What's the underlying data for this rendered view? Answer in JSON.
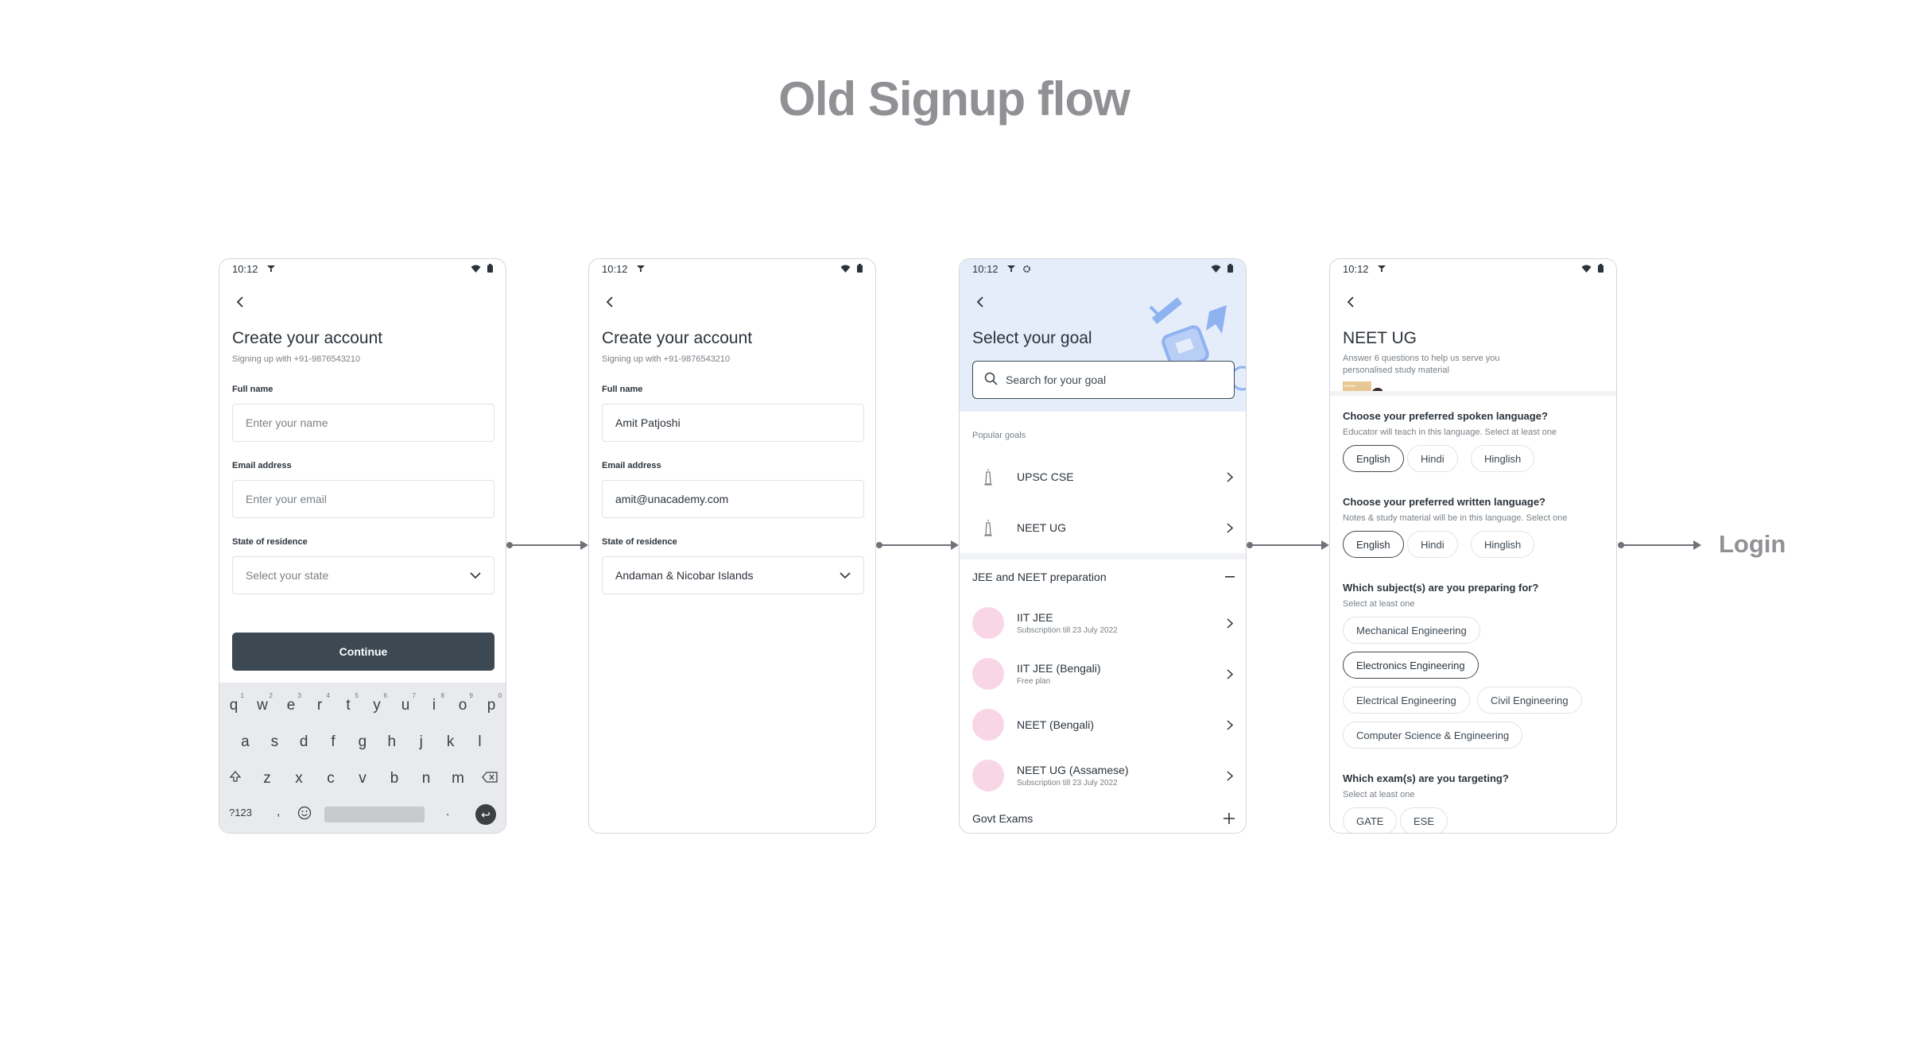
{
  "page": {
    "title": "Old Signup flow",
    "end_label": "Login"
  },
  "statusbar": {
    "time": "10:12"
  },
  "screen1": {
    "title": "Create your account",
    "subtitle": "Signing up with +91-9876543210",
    "fullname_label": "Full name",
    "fullname_placeholder": "Enter your name",
    "email_label": "Email address",
    "email_placeholder": "Enter your email",
    "state_label": "State of residence",
    "state_placeholder": "Select your state",
    "continue_label": "Continue",
    "keyboard": {
      "row1": [
        "q",
        "w",
        "e",
        "r",
        "t",
        "y",
        "u",
        "i",
        "o",
        "p"
      ],
      "row1_nums": [
        "1",
        "2",
        "3",
        "4",
        "5",
        "6",
        "7",
        "8",
        "9",
        "0"
      ],
      "row2": [
        "a",
        "s",
        "d",
        "f",
        "g",
        "h",
        "j",
        "k",
        "l"
      ],
      "row3": [
        "z",
        "x",
        "c",
        "v",
        "b",
        "n",
        "m"
      ],
      "symbols": "?123",
      "comma": ",",
      "period": "."
    }
  },
  "screen2": {
    "title": "Create your account",
    "subtitle": "Signing up with +91-9876543210",
    "fullname_label": "Full name",
    "fullname_value": "Amit Patjoshi",
    "email_label": "Email address",
    "email_value": "amit@unacademy.com",
    "state_label": "State of residence",
    "state_value": "Andaman & Nicobar Islands"
  },
  "screen3": {
    "title": "Select your goal",
    "search_placeholder": "Search for your goal",
    "popular_caption": "Popular goals",
    "popular": [
      {
        "name": "UPSC CSE"
      },
      {
        "name": "NEET UG"
      }
    ],
    "section1_title": "JEE and NEET preparation",
    "section1_items": [
      {
        "name": "IIT JEE",
        "sub": "Subscription till 23 July 2022"
      },
      {
        "name": "IIT JEE (Bengali)",
        "sub": "Free plan"
      },
      {
        "name": "NEET (Bengali)",
        "sub": ""
      },
      {
        "name": "NEET UG (Assamese)",
        "sub": "Subscription till 23 July 2022"
      }
    ],
    "section2_title": "Govt Exams"
  },
  "screen4": {
    "title": "NEET UG",
    "subtitle": "Answer 6 questions to help us serve you personalised study material",
    "q1": "Choose your preferred spoken language?",
    "q1_hint": "Educator will teach in this language. Select at least one",
    "q1_options": [
      "English",
      "Hindi",
      "Hinglish"
    ],
    "q2": "Choose your preferred written language?",
    "q2_hint": "Notes & study material will be in this language. Select one",
    "q2_options": [
      "English",
      "Hindi",
      "Hinglish"
    ],
    "q3": "Which subject(s) are you preparing for?",
    "q3_hint": "Select at least one",
    "q3_options": [
      "Mechanical Engineering",
      "Electronics Engineering",
      "Electrical Engineering",
      "Civil Engineering",
      "Computer Science & Engineering"
    ],
    "q4": "Which exam(s) are you targeting?",
    "q4_hint": "Select at least one",
    "q4_options": [
      "GATE",
      "ESE"
    ]
  }
}
